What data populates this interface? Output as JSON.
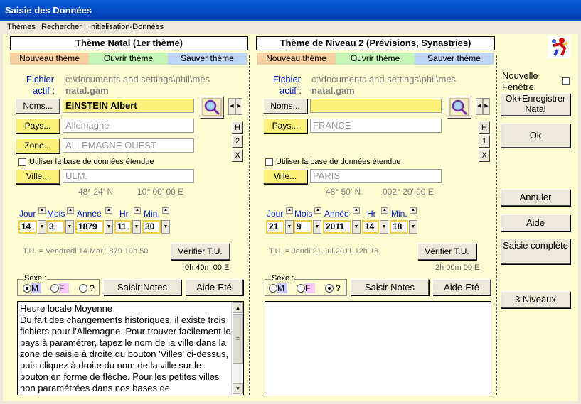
{
  "window": {
    "title": "Saisie des Données"
  },
  "menu": [
    "Thèmes",
    "Rechercher",
    "Initialisation-Données"
  ],
  "left": {
    "title": "Thème Natal (1er thème)",
    "tabs": [
      "Nouveau thème",
      "Ouvrir thème",
      "Sauver thème"
    ],
    "fichier_label1": "Fichier",
    "fichier_label2": "actif :",
    "fichier_path": "c:\\documents and settings\\phil\\mes",
    "fichier_name": "natal.gam",
    "noms_btn": "Noms...",
    "noms_value": "EINSTEIN Albert",
    "pays_btn": "Pays...",
    "pays_value": "Allemagne",
    "zone_btn": "Zone...",
    "zone_value": "ALLEMAGNE OUEST",
    "hbtns": [
      "H",
      "2",
      "X"
    ],
    "etendue": "Utiliser la base de données étendue",
    "ville_btn": "Ville...",
    "ville_value": "ULM.",
    "lat": "48° 24' N",
    "lon": "10° 00' 00 E",
    "date_heads": [
      "Jour",
      "Mois",
      "Année",
      "Hr",
      "Min."
    ],
    "date_values": [
      "14",
      "3",
      "1879",
      "11",
      "30"
    ],
    "tu_text": "T.U. = Vendredi 14.Mar.1879 10h 50",
    "verifier": "Vérifier T.U.",
    "offset": "0h 40m 00 E",
    "sexe": "Sexe :",
    "sex_labels": [
      "M",
      "F",
      "?"
    ],
    "sex_selected": "M",
    "saisir": "Saisir Notes",
    "aide_ete": "Aide-Eté",
    "memo": "Heure locale Moyenne\nDu fait des changements historiques, il existe trois fichiers pour l'Allemagne. Pour trouver facilement le pays à paramétrer, tapez le nom de la ville dans la zone de saisie à droite du bouton 'Villes' ci-dessus, puis cliquez à droite du nom de la ville sur le bouton en forme de flèche. Pour les petites villes non paramétrées dans nos bases de"
  },
  "right": {
    "title": "Thème de Niveau 2 (Prévisions, Synastries)",
    "tabs": [
      "Nouveau thème",
      "Ouvrir thème",
      "Sauver thème"
    ],
    "fichier_label1": "Fichier",
    "fichier_label2": "actif :",
    "fichier_path": "c:\\documents and settings\\phil\\mes",
    "fichier_name": "natal.gam",
    "noms_btn": "Noms...",
    "noms_value": "",
    "pays_btn": "Pays...",
    "pays_value": "FRANCE",
    "hbtns": [
      "H",
      "1",
      "X"
    ],
    "etendue": "Utiliser la base de données étendue",
    "ville_btn": "Ville...",
    "ville_value": "PARIS",
    "lat": "48° 50' N",
    "lon": "002° 20' 00 E",
    "date_heads": [
      "Jour",
      "Mois",
      "Année",
      "Hr",
      "Min."
    ],
    "date_values": [
      "21",
      "9",
      "2011",
      "14",
      "18"
    ],
    "tu_text": "T.U. = Jeudi 21.Jul.2011 12h 18",
    "verifier": "Vérifier T.U.",
    "offset": "2h 00m 00 E",
    "sexe": "Sexe :",
    "sex_labels": [
      "M",
      "F",
      "?"
    ],
    "sex_selected": "?",
    "saisir": "Saisir Notes",
    "aide_ete": "Aide-Eté",
    "memo": ""
  },
  "side": {
    "nouvelle1": "Nouvelle",
    "nouvelle2": "Fenêtre",
    "ok_enreg": "Ok+Enregistrer Natal",
    "ok": "Ok",
    "annuler": "Annuler",
    "aide": "Aide",
    "saisie": "Saisie complète",
    "niveaux": "3 Niveaux"
  },
  "colors": {
    "panel_bg": "#fefed2",
    "yellow_field": "#fbf07a",
    "title_bar": "#0450c8"
  }
}
